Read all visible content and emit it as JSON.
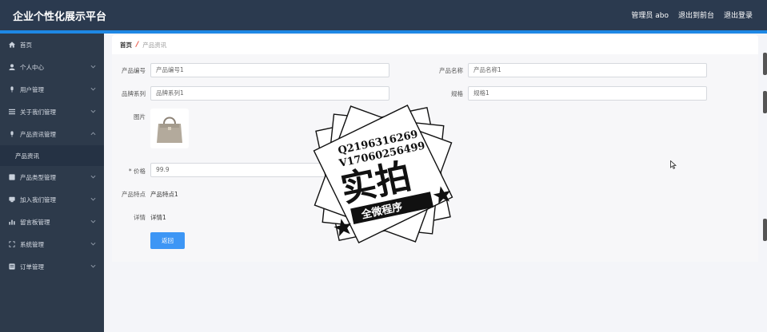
{
  "header": {
    "title": "企业个性化展示平台",
    "admin": "管理员 abo",
    "back_front": "退出到前台",
    "logout": "退出登录"
  },
  "sidebar": {
    "items": [
      {
        "label": "首页",
        "icon": "home-icon"
      },
      {
        "label": "个人中心",
        "icon": "user-icon"
      },
      {
        "label": "用户管理",
        "icon": "users-icon"
      },
      {
        "label": "关于我们管理",
        "icon": "list-icon"
      },
      {
        "label": "产品资讯管理",
        "icon": "news-icon"
      },
      {
        "label": "产品类型管理",
        "icon": "category-icon"
      },
      {
        "label": "加入我们管理",
        "icon": "join-icon"
      },
      {
        "label": "留言板管理",
        "icon": "chart-icon"
      },
      {
        "label": "系统管理",
        "icon": "system-icon"
      },
      {
        "label": "订单管理",
        "icon": "order-icon"
      }
    ],
    "sub_item": "产品资讯"
  },
  "breadcrumb": {
    "home": "首页",
    "separator": "/",
    "current": "产品资讯"
  },
  "form": {
    "code_label": "产品编号",
    "code_value": "产品编号1",
    "name_label": "产品名称",
    "name_value": "产品名称1",
    "brand_label": "品牌系列",
    "brand_value": "品牌系列1",
    "spec_label": "规格",
    "spec_value": "规格1",
    "image_label": "图片",
    "price_label": "* 价格",
    "price_value": "99.9",
    "feature_label": "产品特点",
    "feature_value": "产品特点1",
    "detail_label": "详情",
    "detail_value": "详情1",
    "back_button": "返回"
  },
  "watermark": {
    "line1": "Q2196316269",
    "line2": "V17060256499",
    "main": "实拍",
    "sub": "全微程序"
  },
  "colors": {
    "header_bg": "#2b3a4f",
    "accent": "#1e88e5",
    "sidebar_bg": "#2d3a4b",
    "button": "#3d96f5"
  }
}
